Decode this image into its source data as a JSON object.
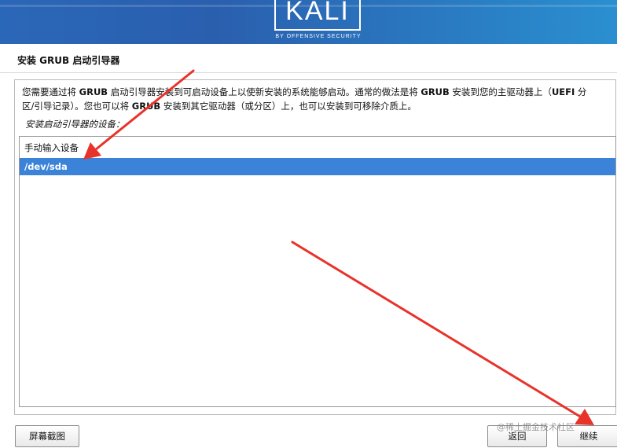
{
  "header": {
    "logo_text": "KALI",
    "logo_subtitle": "BY OFFENSIVE SECURITY",
    "background": "#2b67b8"
  },
  "page": {
    "title": "安装 GRUB 启动引导器"
  },
  "description": {
    "line1_before": "您需要通过将 ",
    "grub1": "GRUB",
    "line1_middle": " 启动引导器安装到可启动设备上以使新安装的系统能够启动。通常的做法是将 ",
    "grub2": "GRUB",
    "line1_after": " 安装到您的主驱动器上（",
    "uefi": "UEFI",
    "line1_end": " 分",
    "line2_before": "区/引导记录）。您也可以将 ",
    "grub3": "GRUB",
    "line2_after": " 安装到其它驱动器（或分区）上，也可以安装到可移除介质上。"
  },
  "prompt": "安装启动引导器的设备：",
  "device_list": {
    "items": [
      {
        "label": "手动输入设备",
        "selected": false
      },
      {
        "label": "/dev/sda",
        "selected": true
      }
    ],
    "selected_color": "#3b83d8"
  },
  "buttons": {
    "screenshot": "屏幕截图",
    "back": "返回",
    "continue": "继续"
  },
  "watermark": "@稀土掘金技术社区",
  "annotation_color": "#e8332a"
}
